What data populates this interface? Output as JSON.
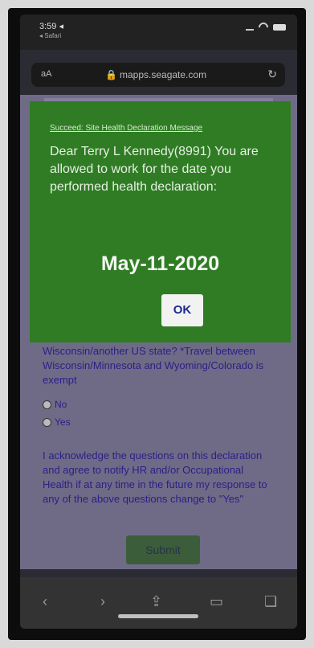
{
  "status_bar": {
    "time": "3:59 ◂",
    "sub_label": "◂ Safari"
  },
  "url_bar": {
    "aa": "aA",
    "url": "mapps.seagate.com",
    "lock_icon": "lock-icon",
    "reload_icon": "reload-icon"
  },
  "modal": {
    "header": "Succeed: Site Health Declaration Message",
    "body": "Dear Terry L Kennedy(8991) You are allowed to work for the date you performed health declaration:",
    "date": "May-11-2020",
    "ok_label": "OK"
  },
  "form": {
    "question": "Wisconsin/another US state? *Travel between Wisconsin/Minnesota and Wyoming/Colorado is exempt",
    "option_no": "No",
    "option_yes": "Yes",
    "acknowledge": "I acknowledge the questions on this declaration and agree to notify HR and/or Occupational Health if at any time in the future my response to any of the above questions change to \"Yes\"",
    "submit_label": "Submit"
  },
  "toolbar": {
    "back": "‹",
    "forward": "›",
    "share": "⇪",
    "bookmarks": "▭",
    "tabs": "❏"
  },
  "colors": {
    "modal_bg": "#2f7c24",
    "page_bg": "#6f6b87",
    "text_link": "#2a1f86"
  }
}
